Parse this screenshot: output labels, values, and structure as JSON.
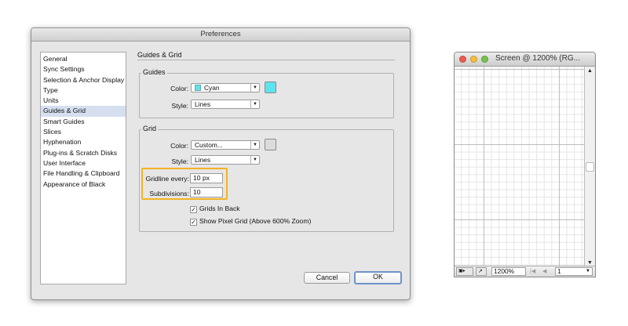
{
  "dialog": {
    "title": "Preferences",
    "sidebar": [
      {
        "label": "General",
        "selected": false
      },
      {
        "label": "Sync Settings",
        "selected": false
      },
      {
        "label": "Selection & Anchor Display",
        "selected": false
      },
      {
        "label": "Type",
        "selected": false
      },
      {
        "label": "Units",
        "selected": false
      },
      {
        "label": "Guides & Grid",
        "selected": true
      },
      {
        "label": "Smart Guides",
        "selected": false
      },
      {
        "label": "Slices",
        "selected": false
      },
      {
        "label": "Hyphenation",
        "selected": false
      },
      {
        "label": "Plug-ins & Scratch Disks",
        "selected": false
      },
      {
        "label": "User Interface",
        "selected": false
      },
      {
        "label": "File Handling & Clipboard",
        "selected": false
      },
      {
        "label": "Appearance of Black",
        "selected": false
      }
    ],
    "section_title": "Guides & Grid",
    "guides": {
      "group_label": "Guides",
      "color_label": "Color:",
      "color_value": "Cyan",
      "color_hex": "#5ee3ee",
      "style_label": "Style:",
      "style_value": "Lines"
    },
    "grid": {
      "group_label": "Grid",
      "color_label": "Color:",
      "color_value": "Custom...",
      "color_hex": "#dcdcdc",
      "style_label": "Style:",
      "style_value": "Lines",
      "gridline_label": "Gridline every:",
      "gridline_value": "10 px",
      "subdivisions_label": "Subdivisions:",
      "subdivisions_value": "10",
      "grids_in_back_label": "Grids In Back",
      "grids_in_back_checked": "✓",
      "pixel_grid_label": "Show Pixel Grid (Above 600% Zoom)",
      "pixel_grid_checked": "✓"
    },
    "buttons": {
      "cancel": "Cancel",
      "ok": "OK"
    }
  },
  "document": {
    "title": "Screen @ 1200% (RG...",
    "zoom": "1200%",
    "artboard": "1"
  },
  "icons": {
    "dropdown_arrow": "▼",
    "scroll_up": "▲",
    "scroll_down": "▼",
    "first_page": "|◀",
    "prev_page": "◀"
  }
}
